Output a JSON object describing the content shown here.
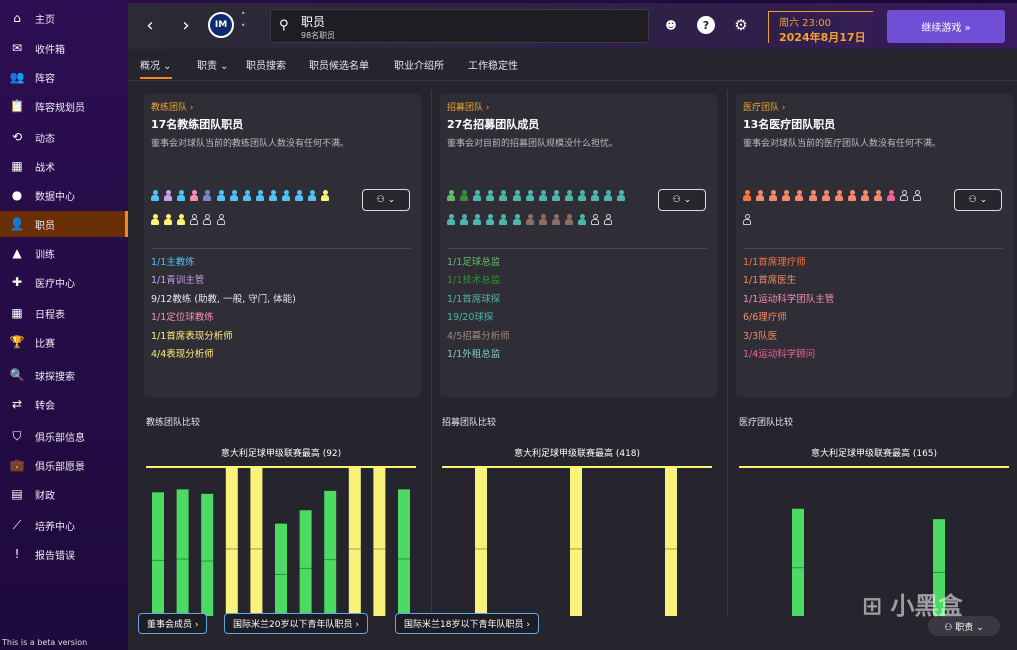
{
  "sidebar": {
    "items": [
      {
        "label": "主页",
        "icon": "home-icon",
        "glyph": "⌂",
        "active": false
      },
      {
        "label": "收件箱",
        "icon": "inbox-icon",
        "glyph": "✉",
        "active": false
      },
      {
        "label": "阵容",
        "icon": "squad-icon",
        "glyph": "👥",
        "active": false
      },
      {
        "label": "阵容规划员",
        "icon": "clipboard-icon",
        "glyph": "📋",
        "active": false
      },
      {
        "label": "动态",
        "icon": "dynamics-icon",
        "glyph": "⟲",
        "active": false
      },
      {
        "label": "战术",
        "icon": "tactics-icon",
        "glyph": "▦",
        "active": false
      },
      {
        "label": "数据中心",
        "icon": "data-icon",
        "glyph": "●",
        "active": false
      },
      {
        "label": "职员",
        "icon": "staff-icon",
        "glyph": "👤",
        "active": true
      },
      {
        "label": "训练",
        "icon": "training-icon",
        "glyph": "▲",
        "active": false
      },
      {
        "label": "医疗中心",
        "icon": "medical-icon",
        "glyph": "✚",
        "active": false
      },
      {
        "label": "日程表",
        "icon": "calendar-icon",
        "glyph": "▦",
        "active": false
      },
      {
        "label": "比赛",
        "icon": "trophy-icon",
        "glyph": "🏆",
        "active": false
      },
      {
        "label": "球探搜索",
        "icon": "search-icon",
        "glyph": "🔍",
        "active": false
      },
      {
        "label": "转会",
        "icon": "transfer-icon",
        "glyph": "⇄",
        "active": false
      },
      {
        "label": "俱乐部信息",
        "icon": "shield-icon",
        "glyph": "⛉",
        "active": false
      },
      {
        "label": "俱乐部愿景",
        "icon": "briefcase-icon",
        "glyph": "💼",
        "active": false
      },
      {
        "label": "财政",
        "icon": "finance-icon",
        "glyph": "▤",
        "active": false
      },
      {
        "label": "培养中心",
        "icon": "development-icon",
        "glyph": "⟋",
        "active": false
      },
      {
        "label": "报告错误",
        "icon": "report-icon",
        "glyph": "!",
        "active": false
      }
    ],
    "beta": "This is a beta version"
  },
  "header": {
    "search_title": "职员",
    "search_sub": "98名职员",
    "club_badge": "IM",
    "date_day": "周六 23:00",
    "date_full": "2024年8月17日",
    "continue_label": "继续游戏  »"
  },
  "tabs": [
    {
      "label": "概况 ⌄",
      "active": true
    },
    {
      "label": "职责 ⌄",
      "active": false
    },
    {
      "label": "职员搜索",
      "active": false
    },
    {
      "label": "职员候选名单",
      "active": false
    },
    {
      "label": "职业介绍所",
      "active": false
    },
    {
      "label": "工作稳定性",
      "active": false
    }
  ],
  "panels": [
    {
      "category": "教练团队 ›",
      "title": "17名教练团队职员",
      "desc": "董事会对球队当前的教练团队人数没有任何不满。",
      "filter": "⚇ ⌄",
      "people_colors": [
        "#4fc3f7",
        "#c9a0f0",
        "#4fc3f7",
        "#f48fb1",
        "#7986cb",
        "#4fc3f7",
        "#4fc3f7",
        "#4fc3f7",
        "#4fc3f7",
        "#4fc3f7",
        "#4fc3f7",
        "#4fc3f7",
        "#4fc3f7",
        "#fff176",
        "#fff176",
        "#fff176",
        "#fff176",
        "empty",
        "empty",
        "empty"
      ],
      "rows": [
        {
          "text": "1/1主教练",
          "color": "#4fc3f7"
        },
        {
          "text": "1/1青训主管",
          "color": "#c9a0f0"
        },
        {
          "text": "9/12教练 (助教, 一般, 守门, 体能)",
          "color": "#e8e8ec"
        },
        {
          "text": "1/1定位球教练",
          "color": "#f48fb1"
        },
        {
          "text": "1/1首席表现分析师",
          "color": "#fff176"
        },
        {
          "text": "4/4表现分析师",
          "color": "#fff176"
        }
      ]
    },
    {
      "category": "招募团队 ›",
      "title": "27名招募团队成员",
      "desc": "董事会对目前的招募团队规模没什么担忧。",
      "filter": "⚇ ⌄",
      "people_colors": [
        "#66bb6a",
        "#388e3c",
        "#4db6ac",
        "#4db6ac",
        "#4db6ac",
        "#4db6ac",
        "#4db6ac",
        "#4db6ac",
        "#4db6ac",
        "#4db6ac",
        "#4db6ac",
        "#4db6ac",
        "#4db6ac",
        "#4db6ac",
        "#4db6ac",
        "#4db6ac",
        "#4db6ac",
        "#4db6ac",
        "#4db6ac",
        "#4db6ac",
        "#8d6e63",
        "#8d6e63",
        "#8d6e63",
        "#8d6e63",
        "#4db6ac",
        "empty",
        "empty"
      ],
      "rows": [
        {
          "text": "1/1足球总监",
          "color": "#66bb6a"
        },
        {
          "text": "1/1技术总监",
          "color": "#388e3c"
        },
        {
          "text": "1/1首席球探",
          "color": "#4db6ac"
        },
        {
          "text": "19/20球探",
          "color": "#4db6ac"
        },
        {
          "text": "4/5招募分析师",
          "color": "#9e8a80"
        },
        {
          "text": "1/1外租总监",
          "color": "#80cbc4"
        }
      ]
    },
    {
      "category": "医疗团队 ›",
      "title": "13名医疗团队职员",
      "desc": "董事会对球队当前的医疗团队人数没有任何不满。",
      "filter": "⚇ ⌄",
      "people_colors": [
        "#ff7043",
        "#f48a6a",
        "#f48a6a",
        "#f48a6a",
        "#f48a6a",
        "#f48a6a",
        "#f48a6a",
        "#f48a6a",
        "#f48a6a",
        "#f48a6a",
        "#f48a6a",
        "#f06292",
        "empty",
        "empty",
        "empty"
      ],
      "rows": [
        {
          "text": "1/1首席理疗师",
          "color": "#ff7043"
        },
        {
          "text": "1/1首席医生",
          "color": "#f48a6a"
        },
        {
          "text": "1/1运动科学团队主管",
          "color": "#f48fb1"
        },
        {
          "text": "6/6理疗师",
          "color": "#f48a6a"
        },
        {
          "text": "3/3队医",
          "color": "#f48a6a"
        },
        {
          "text": "1/4运动科学顾问",
          "color": "#f06292"
        }
      ]
    }
  ],
  "comparisons": [
    {
      "title": "教练团队比较",
      "label": "意大利足球甲级联赛最高 (92)"
    },
    {
      "title": "招募团队比较",
      "label": "意大利足球甲级联赛最高 (418)"
    },
    {
      "title": "医疗团队比较",
      "label": "意大利足球甲级联赛最高 (165)"
    }
  ],
  "chart_data": [
    {
      "type": "bar",
      "title": "教练团队比较",
      "reference_line": 92,
      "reference_label": "意大利足球甲级联赛最高 (92)",
      "values": [
        0.83,
        0.85,
        0.82,
        1,
        1,
        0.62,
        0.71,
        0.84,
        1,
        1,
        0.85
      ],
      "colors": [
        "#4cd964",
        "#4cd964",
        "#4cd964",
        "#f9f27a",
        "#f9f27a",
        "#4cd964",
        "#4cd964",
        "#4cd964",
        "#f9f27a",
        "#f9f27a",
        "#4cd964"
      ]
    },
    {
      "type": "bar",
      "title": "招募团队比较",
      "reference_line": 418,
      "reference_label": "意大利足球甲级联赛最高 (418)",
      "values": [
        1,
        1,
        1
      ],
      "colors": [
        "#f9f27a",
        "#f9f27a",
        "#f9f27a"
      ]
    },
    {
      "type": "bar",
      "title": "医疗团队比较",
      "reference_line": 165,
      "reference_label": "意大利足球甲级联赛最高 (165)",
      "values": [
        0.72,
        0.65
      ],
      "colors": [
        "#4cd964",
        "#4cd964"
      ]
    }
  ],
  "bottom_buttons": [
    "董事会成员 ›",
    "国际米兰20岁以下青年队职员 ›",
    "国际米兰18岁以下青年队职员 ›"
  ],
  "staff_pill": "⚇ 职责 ⌄",
  "watermark": "⊞ 小黑盒"
}
